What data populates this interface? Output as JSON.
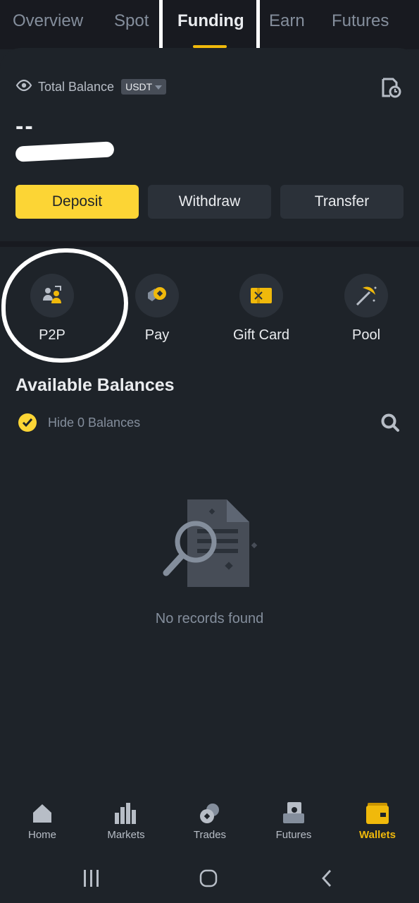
{
  "tabs": [
    {
      "label": "Overview"
    },
    {
      "label": "Spot"
    },
    {
      "label": "Funding"
    },
    {
      "label": "Earn"
    },
    {
      "label": "Futures"
    }
  ],
  "balance": {
    "label": "Total Balance",
    "currency": "USDT",
    "value": "--"
  },
  "actions": {
    "deposit": "Deposit",
    "withdraw": "Withdraw",
    "transfer": "Transfer"
  },
  "services": [
    {
      "label": "P2P",
      "icon": "p2p-icon"
    },
    {
      "label": "Pay",
      "icon": "pay-icon"
    },
    {
      "label": "Gift Card",
      "icon": "gift-card-icon"
    },
    {
      "label": "Pool",
      "icon": "pool-icon"
    }
  ],
  "available": {
    "title": "Available Balances",
    "hide_label": "Hide 0 Balances",
    "empty_text": "No records found"
  },
  "bottom_nav": [
    {
      "label": "Home"
    },
    {
      "label": "Markets"
    },
    {
      "label": "Trades"
    },
    {
      "label": "Futures"
    },
    {
      "label": "Wallets"
    }
  ],
  "colors": {
    "accent": "#fcd535",
    "background": "#1e2329",
    "active_nav": "#f0b90b"
  }
}
